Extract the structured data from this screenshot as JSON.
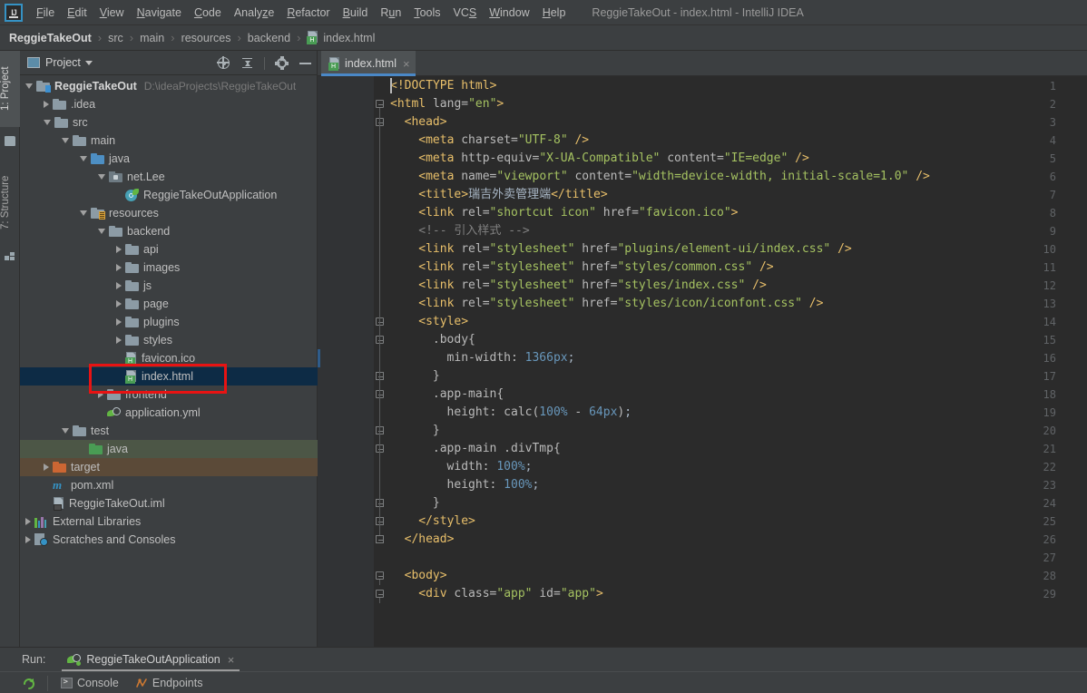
{
  "window": {
    "title": "ReggieTakeOut - index.html - IntelliJ IDEA",
    "logo_text": "IJ"
  },
  "menubar": {
    "items": [
      {
        "label": "File",
        "mnemonic": "F"
      },
      {
        "label": "Edit",
        "mnemonic": "E"
      },
      {
        "label": "View",
        "mnemonic": "V"
      },
      {
        "label": "Navigate",
        "mnemonic": "N"
      },
      {
        "label": "Code",
        "mnemonic": "C"
      },
      {
        "label": "Analyze",
        "mnemonic": "z"
      },
      {
        "label": "Refactor",
        "mnemonic": "R"
      },
      {
        "label": "Build",
        "mnemonic": "B"
      },
      {
        "label": "Run",
        "mnemonic": "u"
      },
      {
        "label": "Tools",
        "mnemonic": "T"
      },
      {
        "label": "VCS",
        "mnemonic": "S"
      },
      {
        "label": "Window",
        "mnemonic": "W"
      },
      {
        "label": "Help",
        "mnemonic": "H"
      }
    ]
  },
  "breadcrumb": {
    "separator": "›",
    "items": [
      "ReggieTakeOut",
      "src",
      "main",
      "resources",
      "backend",
      "index.html"
    ]
  },
  "left_tool_tabs": [
    {
      "label": "1: Project",
      "active": true,
      "icon": "folder-icon"
    },
    {
      "label": "7: Structure",
      "active": false,
      "icon": "structure-icon"
    }
  ],
  "project_panel": {
    "title": "Project",
    "tools": [
      {
        "name": "locate-icon",
        "label": "Select Opened File"
      },
      {
        "name": "collapse-all-icon",
        "label": "Collapse All"
      },
      {
        "name": "gear-icon",
        "label": "Settings"
      },
      {
        "name": "minimize-icon",
        "label": "Hide"
      }
    ],
    "tree": [
      {
        "depth": 0,
        "label": "ReggieTakeOut",
        "hint": "D:\\ideaProjects\\ReggieTakeOut",
        "icon": "module-folder-icon",
        "arrow": "open",
        "state": "root"
      },
      {
        "depth": 1,
        "label": ".idea",
        "icon": "folder-icon",
        "arrow": "closed",
        "state": "normal"
      },
      {
        "depth": 1,
        "label": "src",
        "icon": "folder-icon",
        "arrow": "open",
        "state": "normal"
      },
      {
        "depth": 2,
        "label": "main",
        "icon": "folder-icon",
        "arrow": "open",
        "state": "normal"
      },
      {
        "depth": 3,
        "label": "java",
        "icon": "sources-root-icon",
        "arrow": "open",
        "state": "normal"
      },
      {
        "depth": 4,
        "label": "net.Lee",
        "icon": "package-icon",
        "arrow": "open",
        "state": "normal"
      },
      {
        "depth": 5,
        "label": "ReggieTakeOutApplication",
        "icon": "spring-boot-class-icon",
        "arrow": "none",
        "state": "normal"
      },
      {
        "depth": 3,
        "label": "resources",
        "icon": "resources-root-icon",
        "arrow": "open",
        "state": "normal"
      },
      {
        "depth": 4,
        "label": "backend",
        "icon": "folder-icon",
        "arrow": "open",
        "state": "normal"
      },
      {
        "depth": 5,
        "label": "api",
        "icon": "folder-icon",
        "arrow": "closed",
        "state": "normal"
      },
      {
        "depth": 5,
        "label": "images",
        "icon": "folder-icon",
        "arrow": "closed",
        "state": "normal"
      },
      {
        "depth": 5,
        "label": "js",
        "icon": "folder-icon",
        "arrow": "closed",
        "state": "normal"
      },
      {
        "depth": 5,
        "label": "page",
        "icon": "folder-icon",
        "arrow": "closed",
        "state": "normal"
      },
      {
        "depth": 5,
        "label": "plugins",
        "icon": "folder-icon",
        "arrow": "closed",
        "state": "normal"
      },
      {
        "depth": 5,
        "label": "styles",
        "icon": "folder-icon",
        "arrow": "closed",
        "state": "normal"
      },
      {
        "depth": 5,
        "label": "favicon.ico",
        "icon": "html-file-icon",
        "arrow": "none",
        "state": "normal"
      },
      {
        "depth": 5,
        "label": "index.html",
        "icon": "html-file-icon",
        "arrow": "none",
        "state": "selected"
      },
      {
        "depth": 4,
        "label": "frontend",
        "icon": "folder-icon",
        "arrow": "closed",
        "state": "normal"
      },
      {
        "depth": 4,
        "label": "application.yml",
        "icon": "spring-yaml-icon",
        "arrow": "none",
        "state": "normal"
      },
      {
        "depth": 2,
        "label": "test",
        "icon": "folder-icon",
        "arrow": "open",
        "state": "normal"
      },
      {
        "depth": 3,
        "label": "java",
        "icon": "test-sources-root-icon",
        "arrow": "none",
        "state": "test-source-root"
      },
      {
        "depth": 1,
        "label": "target",
        "icon": "excluded-folder-icon",
        "arrow": "closed",
        "state": "excluded"
      },
      {
        "depth": 1,
        "label": "pom.xml",
        "icon": "maven-icon",
        "arrow": "none",
        "state": "normal"
      },
      {
        "depth": 1,
        "label": "ReggieTakeOut.iml",
        "icon": "iml-file-icon",
        "arrow": "none",
        "state": "normal"
      },
      {
        "depth": 0,
        "label": "External Libraries",
        "icon": "library-icon",
        "arrow": "closed",
        "state": "normal"
      },
      {
        "depth": 0,
        "label": "Scratches and Consoles",
        "icon": "scratches-icon",
        "arrow": "closed",
        "state": "normal"
      }
    ],
    "annotation": {
      "color": "#e81313",
      "target": "index.html"
    }
  },
  "editor": {
    "tabs": [
      {
        "label": "index.html",
        "icon": "html-file-icon",
        "active": true,
        "close": "×"
      }
    ],
    "caret_line": 16,
    "lines": [
      {
        "n": 1,
        "fold": "",
        "tokens": [
          {
            "t": "tag",
            "v": "<!DOCTYPE html>"
          }
        ],
        "indent": 0
      },
      {
        "n": 2,
        "fold": "open",
        "tokens": [
          {
            "t": "tag",
            "v": "<html "
          },
          {
            "t": "attr",
            "v": "lang="
          },
          {
            "t": "str",
            "v": "\"en\""
          },
          {
            "t": "tag",
            "v": ">"
          }
        ],
        "indent": 0
      },
      {
        "n": 3,
        "fold": "open",
        "tokens": [
          {
            "t": "tag",
            "v": "<head>"
          }
        ],
        "indent": 1
      },
      {
        "n": 4,
        "fold": "",
        "tokens": [
          {
            "t": "tag",
            "v": "<meta "
          },
          {
            "t": "attr",
            "v": "charset="
          },
          {
            "t": "str",
            "v": "\"UTF-8\""
          },
          {
            "t": "txt",
            "v": " "
          },
          {
            "t": "tag",
            "v": "/>"
          }
        ],
        "indent": 2
      },
      {
        "n": 5,
        "fold": "",
        "tokens": [
          {
            "t": "tag",
            "v": "<meta "
          },
          {
            "t": "attr",
            "v": "http-equiv="
          },
          {
            "t": "str",
            "v": "\"X-UA-Compatible\""
          },
          {
            "t": "attr",
            "v": " content="
          },
          {
            "t": "str",
            "v": "\"IE=edge\""
          },
          {
            "t": "txt",
            "v": " "
          },
          {
            "t": "tag",
            "v": "/>"
          }
        ],
        "indent": 2
      },
      {
        "n": 6,
        "fold": "",
        "tokens": [
          {
            "t": "tag",
            "v": "<meta "
          },
          {
            "t": "attr",
            "v": "name="
          },
          {
            "t": "str",
            "v": "\"viewport\""
          },
          {
            "t": "attr",
            "v": " content="
          },
          {
            "t": "str",
            "v": "\"width=device-width, initial-scale=1.0\""
          },
          {
            "t": "txt",
            "v": " "
          },
          {
            "t": "tag",
            "v": "/>"
          }
        ],
        "indent": 2
      },
      {
        "n": 7,
        "fold": "",
        "tokens": [
          {
            "t": "tag",
            "v": "<title>"
          },
          {
            "t": "txt",
            "v": "瑞吉外卖管理端"
          },
          {
            "t": "tag",
            "v": "</title>"
          }
        ],
        "indent": 2
      },
      {
        "n": 8,
        "fold": "",
        "tokens": [
          {
            "t": "tag",
            "v": "<link "
          },
          {
            "t": "attr",
            "v": "rel="
          },
          {
            "t": "str",
            "v": "\"shortcut icon\""
          },
          {
            "t": "attr",
            "v": " href="
          },
          {
            "t": "str",
            "v": "\"favicon.ico\""
          },
          {
            "t": "tag",
            "v": ">"
          }
        ],
        "indent": 2
      },
      {
        "n": 9,
        "fold": "",
        "tokens": [
          {
            "t": "com",
            "v": "<!-- 引入样式 -->"
          }
        ],
        "indent": 2
      },
      {
        "n": 10,
        "fold": "",
        "tokens": [
          {
            "t": "tag",
            "v": "<link "
          },
          {
            "t": "attr",
            "v": "rel="
          },
          {
            "t": "str",
            "v": "\"stylesheet\""
          },
          {
            "t": "attr",
            "v": " href="
          },
          {
            "t": "str",
            "v": "\"plugins/element-ui/index.css\""
          },
          {
            "t": "txt",
            "v": " "
          },
          {
            "t": "tag",
            "v": "/>"
          }
        ],
        "indent": 2
      },
      {
        "n": 11,
        "fold": "",
        "tokens": [
          {
            "t": "tag",
            "v": "<link "
          },
          {
            "t": "attr",
            "v": "rel="
          },
          {
            "t": "str",
            "v": "\"stylesheet\""
          },
          {
            "t": "attr",
            "v": " href="
          },
          {
            "t": "str",
            "v": "\"styles/common.css\""
          },
          {
            "t": "txt",
            "v": " "
          },
          {
            "t": "tag",
            "v": "/>"
          }
        ],
        "indent": 2
      },
      {
        "n": 12,
        "fold": "",
        "tokens": [
          {
            "t": "tag",
            "v": "<link "
          },
          {
            "t": "attr",
            "v": "rel="
          },
          {
            "t": "str",
            "v": "\"stylesheet\""
          },
          {
            "t": "attr",
            "v": " href="
          },
          {
            "t": "str",
            "v": "\"styles/index.css\""
          },
          {
            "t": "txt",
            "v": " "
          },
          {
            "t": "tag",
            "v": "/>"
          }
        ],
        "indent": 2
      },
      {
        "n": 13,
        "fold": "",
        "tokens": [
          {
            "t": "tag",
            "v": "<link "
          },
          {
            "t": "attr",
            "v": "rel="
          },
          {
            "t": "str",
            "v": "\"stylesheet\""
          },
          {
            "t": "attr",
            "v": " href="
          },
          {
            "t": "str",
            "v": "\"styles/icon/iconfont.css\""
          },
          {
            "t": "txt",
            "v": " "
          },
          {
            "t": "tag",
            "v": "/>"
          }
        ],
        "indent": 2
      },
      {
        "n": 14,
        "fold": "open",
        "tokens": [
          {
            "t": "tag",
            "v": "<style>"
          }
        ],
        "indent": 2
      },
      {
        "n": 15,
        "fold": "open",
        "tokens": [
          {
            "t": "attr",
            "v": ".body{"
          }
        ],
        "indent": 3
      },
      {
        "n": 16,
        "fold": "",
        "tokens": [
          {
            "t": "attr",
            "v": "min-width: "
          },
          {
            "t": "num",
            "v": "1366px"
          },
          {
            "t": "punc",
            "v": ";"
          }
        ],
        "indent": 4
      },
      {
        "n": 17,
        "fold": "end",
        "tokens": [
          {
            "t": "attr",
            "v": "}"
          }
        ],
        "indent": 3
      },
      {
        "n": 18,
        "fold": "open",
        "tokens": [
          {
            "t": "attr",
            "v": ".app-main{"
          }
        ],
        "indent": 3
      },
      {
        "n": 19,
        "fold": "",
        "tokens": [
          {
            "t": "attr",
            "v": "height: calc("
          },
          {
            "t": "num",
            "v": "100%"
          },
          {
            "t": "attr",
            "v": " - "
          },
          {
            "t": "num",
            "v": "64px"
          },
          {
            "t": "attr",
            "v": ")"
          },
          {
            "t": "punc",
            "v": ";"
          }
        ],
        "indent": 4
      },
      {
        "n": 20,
        "fold": "end",
        "tokens": [
          {
            "t": "attr",
            "v": "}"
          }
        ],
        "indent": 3
      },
      {
        "n": 21,
        "fold": "open",
        "tokens": [
          {
            "t": "attr",
            "v": ".app-main .divTmp{"
          }
        ],
        "indent": 3
      },
      {
        "n": 22,
        "fold": "",
        "tokens": [
          {
            "t": "attr",
            "v": "width: "
          },
          {
            "t": "num",
            "v": "100%"
          },
          {
            "t": "punc",
            "v": ";"
          }
        ],
        "indent": 4
      },
      {
        "n": 23,
        "fold": "",
        "tokens": [
          {
            "t": "attr",
            "v": "height: "
          },
          {
            "t": "num",
            "v": "100%"
          },
          {
            "t": "punc",
            "v": ";"
          }
        ],
        "indent": 4
      },
      {
        "n": 24,
        "fold": "end",
        "tokens": [
          {
            "t": "attr",
            "v": "}"
          }
        ],
        "indent": 3
      },
      {
        "n": 25,
        "fold": "end",
        "tokens": [
          {
            "t": "tag",
            "v": "</style>"
          }
        ],
        "indent": 2
      },
      {
        "n": 26,
        "fold": "end",
        "tokens": [
          {
            "t": "tag",
            "v": "</head>"
          }
        ],
        "indent": 1
      },
      {
        "n": 27,
        "fold": "",
        "tokens": [],
        "indent": 0
      },
      {
        "n": 28,
        "fold": "open",
        "tokens": [
          {
            "t": "tag",
            "v": "<body>"
          }
        ],
        "indent": 1
      },
      {
        "n": 29,
        "fold": "open",
        "tokens": [
          {
            "t": "tag",
            "v": "<div "
          },
          {
            "t": "attr",
            "v": "class="
          },
          {
            "t": "str",
            "v": "\"app\""
          },
          {
            "t": "attr",
            "v": " id="
          },
          {
            "t": "str",
            "v": "\"app\""
          },
          {
            "t": "tag",
            "v": ">"
          }
        ],
        "indent": 2
      }
    ]
  },
  "run_panel": {
    "label": "Run:",
    "tab": {
      "name": "ReggieTakeOutApplication",
      "close": "×",
      "icon": "spring-run-icon"
    },
    "subtabs": [
      {
        "label": "Console",
        "icon": "console-icon"
      },
      {
        "label": "Endpoints",
        "icon": "endpoints-icon"
      }
    ],
    "rerun_button": "rerun-icon"
  },
  "colors": {
    "panel_bg": "#3c3f41",
    "editor_bg": "#2b2b2b",
    "gutter_bg": "#313335",
    "selection": "#0d2b45",
    "accent": "#4a88c7",
    "annotation_red": "#e81313",
    "tag": "#e8bf6a",
    "string": "#a5c261",
    "number": "#6897bb",
    "comment": "#808080",
    "text": "#a9b7c6",
    "test_source_root": "#4c5646",
    "excluded": "#5b4a38"
  }
}
